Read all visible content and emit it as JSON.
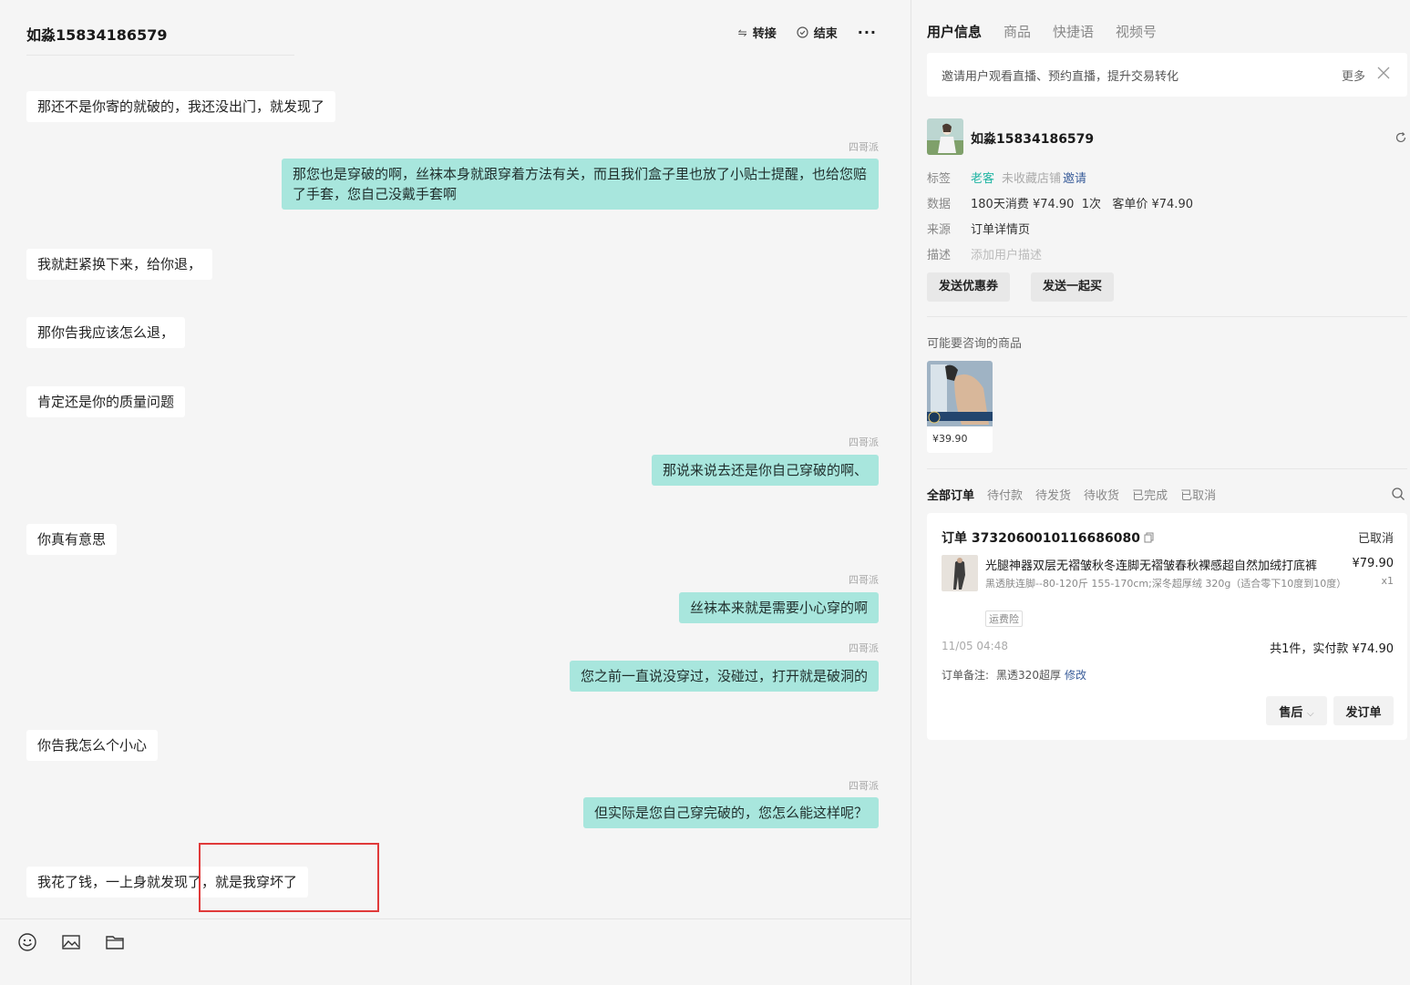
{
  "chat": {
    "title": "如淼15834186579",
    "actions": {
      "transfer": "转接",
      "end": "结束",
      "more": "···"
    },
    "messages": [
      {
        "dir": "in",
        "text": "那还不是你寄的就破的，我还没出门，就发现了"
      },
      {
        "dir": "out",
        "sender": "四哥派",
        "text": "那您也是穿破的啊，丝袜本身就跟穿着方法有关，而且我们盒子里也放了小贴士提醒，也给您赔了手套，您自己没戴手套啊"
      },
      {
        "dir": "in",
        "text": "我就赶紧换下来，给你退，"
      },
      {
        "dir": "in",
        "text": "那你告我应该怎么退，"
      },
      {
        "dir": "in",
        "text": "肯定还是你的质量问题"
      },
      {
        "dir": "out",
        "sender": "四哥派",
        "text": "那说来说去还是你自己穿破的啊、"
      },
      {
        "dir": "in",
        "text": "你真有意思"
      },
      {
        "dir": "out",
        "sender": "四哥派",
        "text": "丝袜本来就是需要小心穿的啊"
      },
      {
        "dir": "out",
        "sender": "四哥派",
        "text": "您之前一直说没穿过，没碰过，打开就是破洞的"
      },
      {
        "dir": "in",
        "text": "你告我怎么个小心"
      },
      {
        "dir": "out",
        "sender": "四哥派",
        "text": "但实际是您自己穿完破的，您怎么能这样呢？"
      },
      {
        "dir": "in",
        "text": "我花了钱，一上身就发现了，就是我穿坏了"
      }
    ],
    "composer_icons": [
      "emoji-icon",
      "image-icon",
      "folder-icon"
    ]
  },
  "side": {
    "tabs": [
      "用户信息",
      "商品",
      "快捷语",
      "视频号"
    ],
    "notice": {
      "text": "邀请用户观看直播、预约直播，提升交易转化",
      "more": "更多"
    },
    "user": {
      "name": "如淼15834186579",
      "tag_label": "标签",
      "tag_old": "老客",
      "tag_unfav": "未收藏店铺",
      "tag_invite": "邀请",
      "data_label": "数据",
      "data_value": "180天消费 ¥74.90  1次   客单价 ¥74.90",
      "source_label": "来源",
      "source_value": "订单详情页",
      "desc_label": "描述",
      "desc_placeholder": "添加用户描述",
      "btn_coupon": "发送优惠券",
      "btn_together": "发送一起买"
    },
    "consult": {
      "title": "可能要咨询的商品",
      "price": "¥39.90"
    },
    "order_tabs": [
      "全部订单",
      "待付款",
      "待发货",
      "待收货",
      "已完成",
      "已取消"
    ],
    "order": {
      "number": "订单 3732060010116686080",
      "status": "已取消",
      "item_name": "光腿神器双层无褶皱秋冬连脚无褶皱春秋裸感超自然加绒打底裤",
      "item_spec": "黑透肤连脚--80-120斤 155-170cm;深冬超厚绒 320g（适合零下10度到10度）",
      "item_badge": "运费险",
      "item_price": "¥79.90",
      "item_qty": "x1",
      "time": "11/05 04:48",
      "total": "共1件，实付款 ¥74.90",
      "remark_label": "订单备注:",
      "remark_value": "黑透320超厚",
      "remark_edit": "修改",
      "btn_after": "售后",
      "btn_send": "发订单"
    }
  },
  "colors": {
    "outgoing_bubble": "#a8e6dd",
    "incoming_bubble": "#ffffff",
    "highlight": "#e03a3a",
    "tag_green": "#1fb4a3"
  }
}
